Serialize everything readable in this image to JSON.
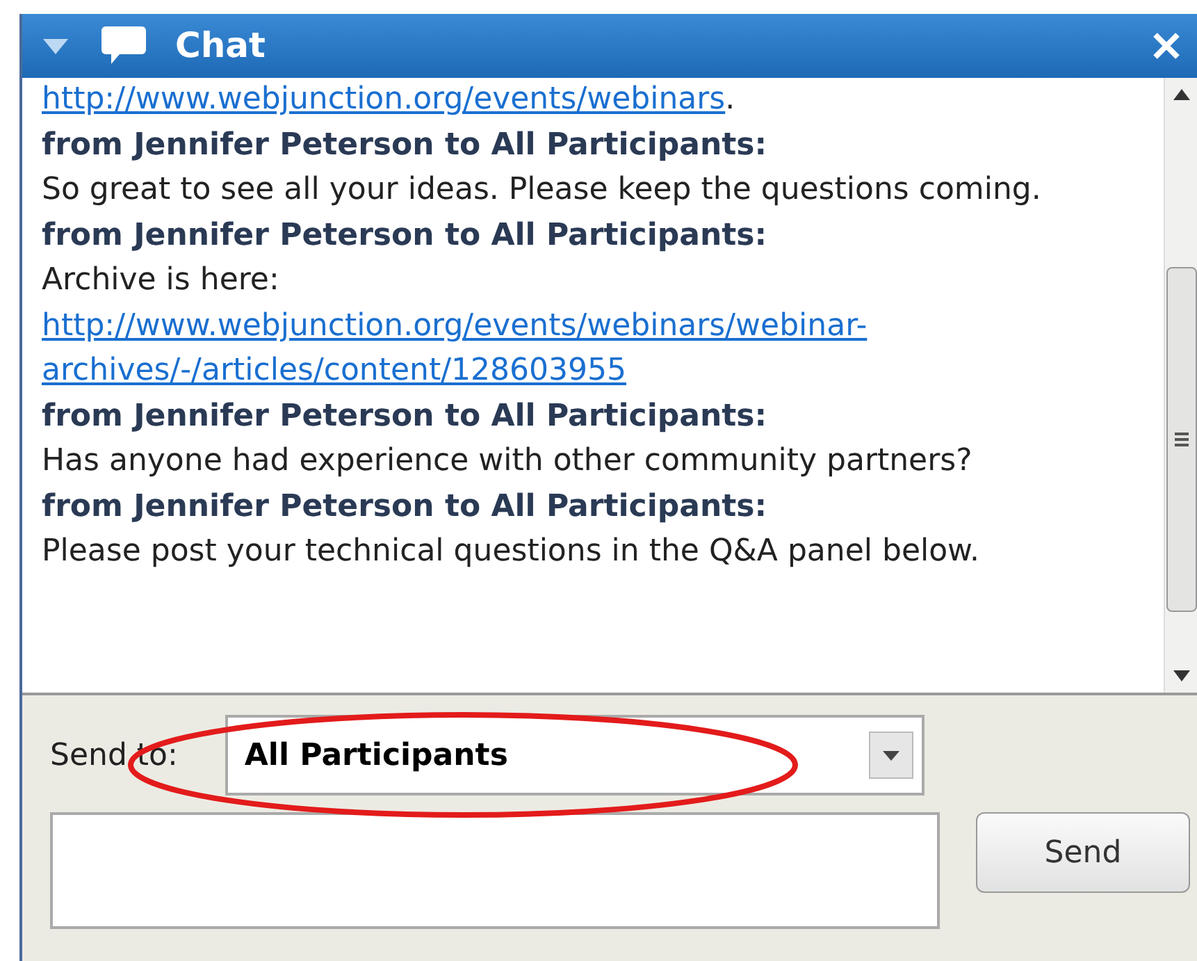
{
  "window": {
    "title": "Chat",
    "expanded": true
  },
  "messages": [
    {
      "kind": "link",
      "text": "http://www.webjunction.org/events/webinars",
      "suffix": "."
    },
    {
      "kind": "sender",
      "text": "from Jennifer Peterson to All Participants:"
    },
    {
      "kind": "message",
      "text": "So great to see all your ideas. Please keep the questions coming."
    },
    {
      "kind": "sender",
      "text": "from Jennifer Peterson to All Participants:"
    },
    {
      "kind": "message",
      "text": "Archive is here:"
    },
    {
      "kind": "link",
      "text": "http://www.webjunction.org/events/webinars/webinar-archives/-/articles/content/128603955"
    },
    {
      "kind": "sender",
      "text": "from Jennifer Peterson to All Participants:"
    },
    {
      "kind": "message",
      "text": "Has anyone had experience with other community partners?"
    },
    {
      "kind": "sender",
      "text": "from Jennifer Peterson to All Participants:"
    },
    {
      "kind": "message",
      "text": "Please post your technical questions in the Q&A panel below."
    }
  ],
  "send_to": {
    "label": "Send to:",
    "value": "All Participants"
  },
  "send_button": "Send"
}
